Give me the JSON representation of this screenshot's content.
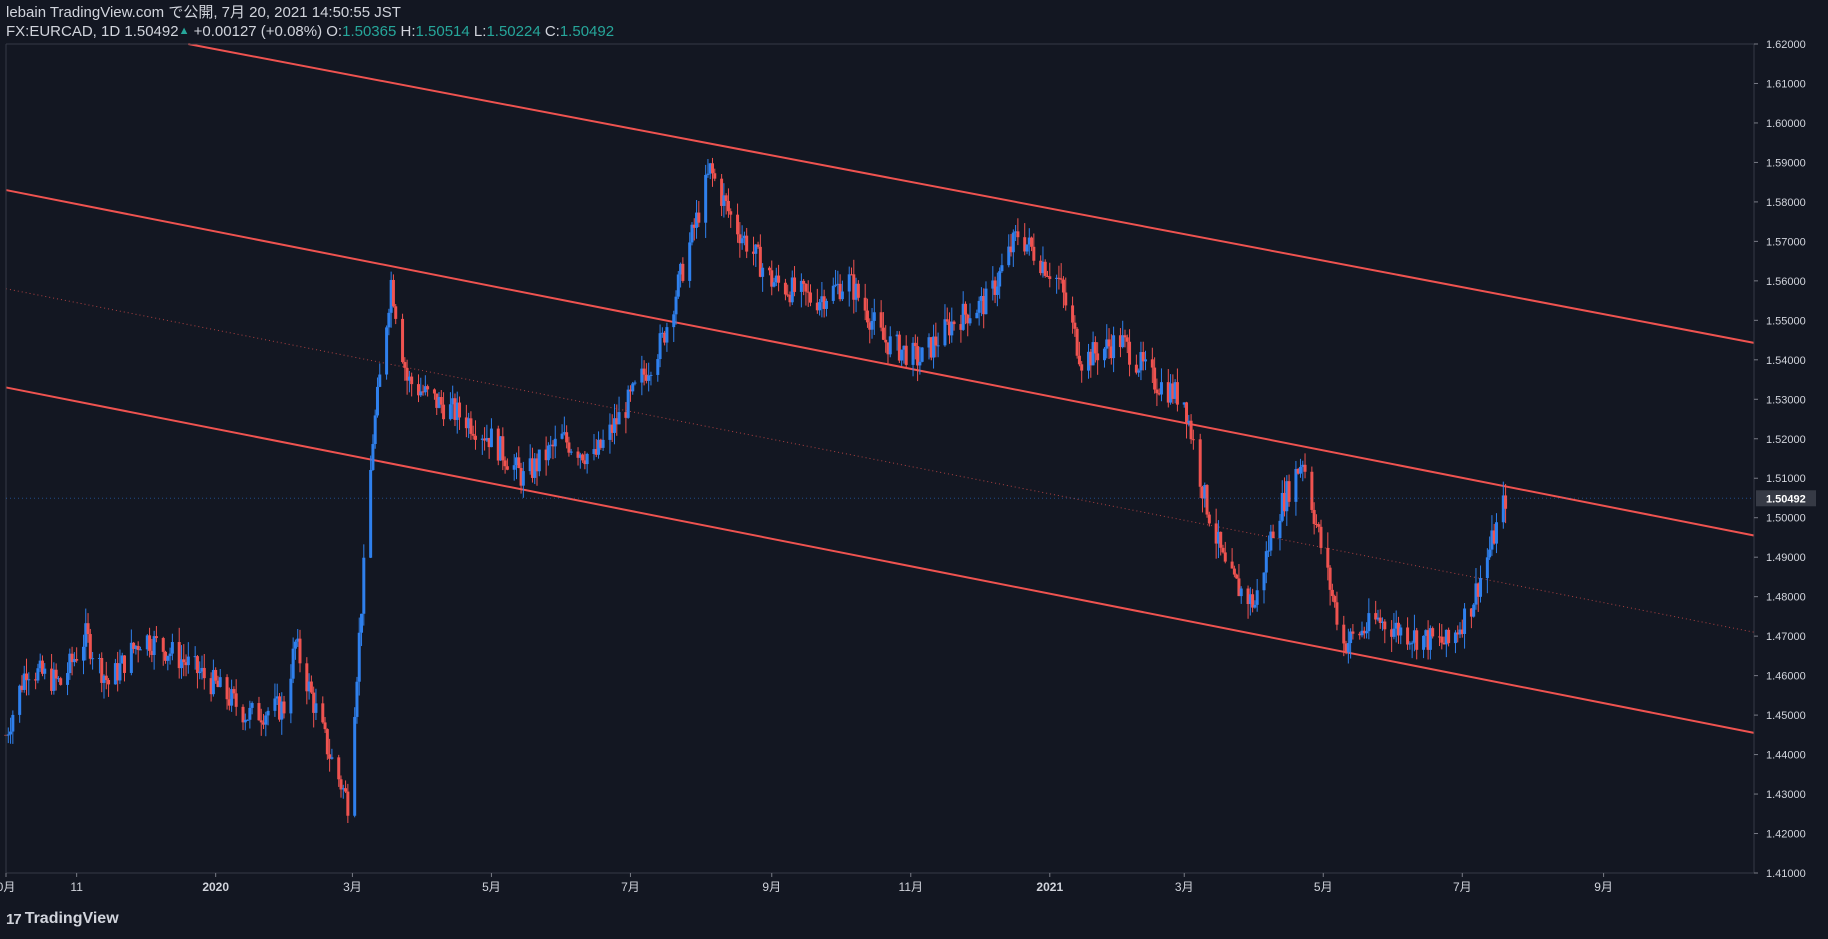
{
  "header": {
    "line1": "lebain TradingView.com で公開, 7月 20, 2021 14:50:55 JST",
    "symbol": "FX:EURCAD, 1D",
    "last": "1.50492",
    "change": "+0.00127 (+0.08%)",
    "o_label": "O:",
    "o": "1.50365",
    "h_label": "H:",
    "h": "1.50514",
    "l_label": "L:",
    "l": "1.50224",
    "c_label": "C:",
    "c": "1.50492"
  },
  "footer": {
    "logo_mark": "17",
    "logo_text": "TradingView"
  },
  "colors": {
    "bg": "#131722",
    "up": "#2f80ed",
    "down": "#ef5350",
    "channel": "#ef5350",
    "text": "#d1d4dc",
    "accent": "#26a69a"
  },
  "chart_data": {
    "type": "candlestick",
    "symbol": "FX:EURCAD",
    "interval": "1D",
    "ylim": [
      1.41,
      1.62
    ],
    "y_ticks": [
      "1.41000",
      "1.42000",
      "1.43000",
      "1.44000",
      "1.45000",
      "1.46000",
      "1.47000",
      "1.48000",
      "1.49000",
      "1.50000",
      "1.51000",
      "1.52000",
      "1.53000",
      "1.54000",
      "1.55000",
      "1.56000",
      "1.57000",
      "1.58000",
      "1.59000",
      "1.60000",
      "1.61000",
      "1.62000"
    ],
    "last_price_label": "1.50492",
    "x_ticks": [
      {
        "label": "0月",
        "date": "2019-10-01"
      },
      {
        "label": "11",
        "date": "2019-11-01"
      },
      {
        "label": "2020",
        "date": "2020-01-01"
      },
      {
        "label": "3月",
        "date": "2020-03-01"
      },
      {
        "label": "5月",
        "date": "2020-05-01"
      },
      {
        "label": "7月",
        "date": "2020-07-01"
      },
      {
        "label": "9月",
        "date": "2020-09-01"
      },
      {
        "label": "11月",
        "date": "2020-11-01"
      },
      {
        "label": "2021",
        "date": "2021-01-01"
      },
      {
        "label": "3月",
        "date": "2021-03-01"
      },
      {
        "label": "5月",
        "date": "2021-05-01"
      },
      {
        "label": "7月",
        "date": "2021-07-01"
      },
      {
        "label": "9月",
        "date": "2021-09-01"
      }
    ],
    "x_range": [
      "2019-10-01",
      "2021-11-06"
    ],
    "series_path": [
      [
        "2019-10-01",
        1.445
      ],
      [
        "2019-10-10",
        1.462
      ],
      [
        "2019-10-25",
        1.458
      ],
      [
        "2019-11-05",
        1.47
      ],
      [
        "2019-11-15",
        1.458
      ],
      [
        "2019-11-30",
        1.47
      ],
      [
        "2019-12-15",
        1.465
      ],
      [
        "2019-12-31",
        1.458
      ],
      [
        "2020-01-15",
        1.45
      ],
      [
        "2020-01-31",
        1.452
      ],
      [
        "2020-02-05",
        1.468
      ],
      [
        "2020-02-20",
        1.44
      ],
      [
        "2020-02-28",
        1.428
      ],
      [
        "2020-03-05",
        1.478
      ],
      [
        "2020-03-10",
        1.52
      ],
      [
        "2020-03-18",
        1.56
      ],
      [
        "2020-03-25",
        1.535
      ],
      [
        "2020-04-05",
        1.53
      ],
      [
        "2020-04-20",
        1.525
      ],
      [
        "2020-05-01",
        1.52
      ],
      [
        "2020-05-15",
        1.51
      ],
      [
        "2020-06-01",
        1.52
      ],
      [
        "2020-06-15",
        1.515
      ],
      [
        "2020-07-01",
        1.53
      ],
      [
        "2020-07-15",
        1.545
      ],
      [
        "2020-07-25",
        1.565
      ],
      [
        "2020-08-05",
        1.588
      ],
      [
        "2020-08-15",
        1.575
      ],
      [
        "2020-09-01",
        1.56
      ],
      [
        "2020-09-20",
        1.555
      ],
      [
        "2020-10-05",
        1.56
      ],
      [
        "2020-10-20",
        1.545
      ],
      [
        "2020-11-05",
        1.54
      ],
      [
        "2020-11-20",
        1.55
      ],
      [
        "2020-12-05",
        1.555
      ],
      [
        "2020-12-18",
        1.572
      ],
      [
        "2021-01-05",
        1.56
      ],
      [
        "2021-01-15",
        1.54
      ],
      [
        "2021-02-01",
        1.545
      ],
      [
        "2021-02-15",
        1.535
      ],
      [
        "2021-03-01",
        1.53
      ],
      [
        "2021-03-10",
        1.505
      ],
      [
        "2021-03-20",
        1.485
      ],
      [
        "2021-04-01",
        1.478
      ],
      [
        "2021-04-10",
        1.5
      ],
      [
        "2021-04-22",
        1.515
      ],
      [
        "2021-05-01",
        1.49
      ],
      [
        "2021-05-10",
        1.468
      ],
      [
        "2021-05-25",
        1.474
      ],
      [
        "2021-06-10",
        1.47
      ],
      [
        "2021-06-25",
        1.468
      ],
      [
        "2021-07-05",
        1.478
      ],
      [
        "2021-07-12",
        1.49
      ],
      [
        "2021-07-20",
        1.50492
      ]
    ],
    "annotations": {
      "channel_lines": [
        {
          "name": "upper",
          "start": [
            "2019-12-20",
            1.62
          ],
          "end": [
            "2021-11-06",
            1.5443
          ]
        },
        {
          "name": "middle",
          "start": [
            "2019-10-01",
            1.583
          ],
          "end": [
            "2021-11-06",
            1.4955
          ]
        },
        {
          "name": "lower",
          "start": [
            "2019-10-01",
            1.533
          ],
          "end": [
            "2021-11-06",
            1.4455
          ]
        }
      ],
      "median_dotted": {
        "start": [
          "2019-10-01",
          1.558
        ],
        "end": [
          "2021-11-06",
          1.471
        ]
      }
    }
  }
}
